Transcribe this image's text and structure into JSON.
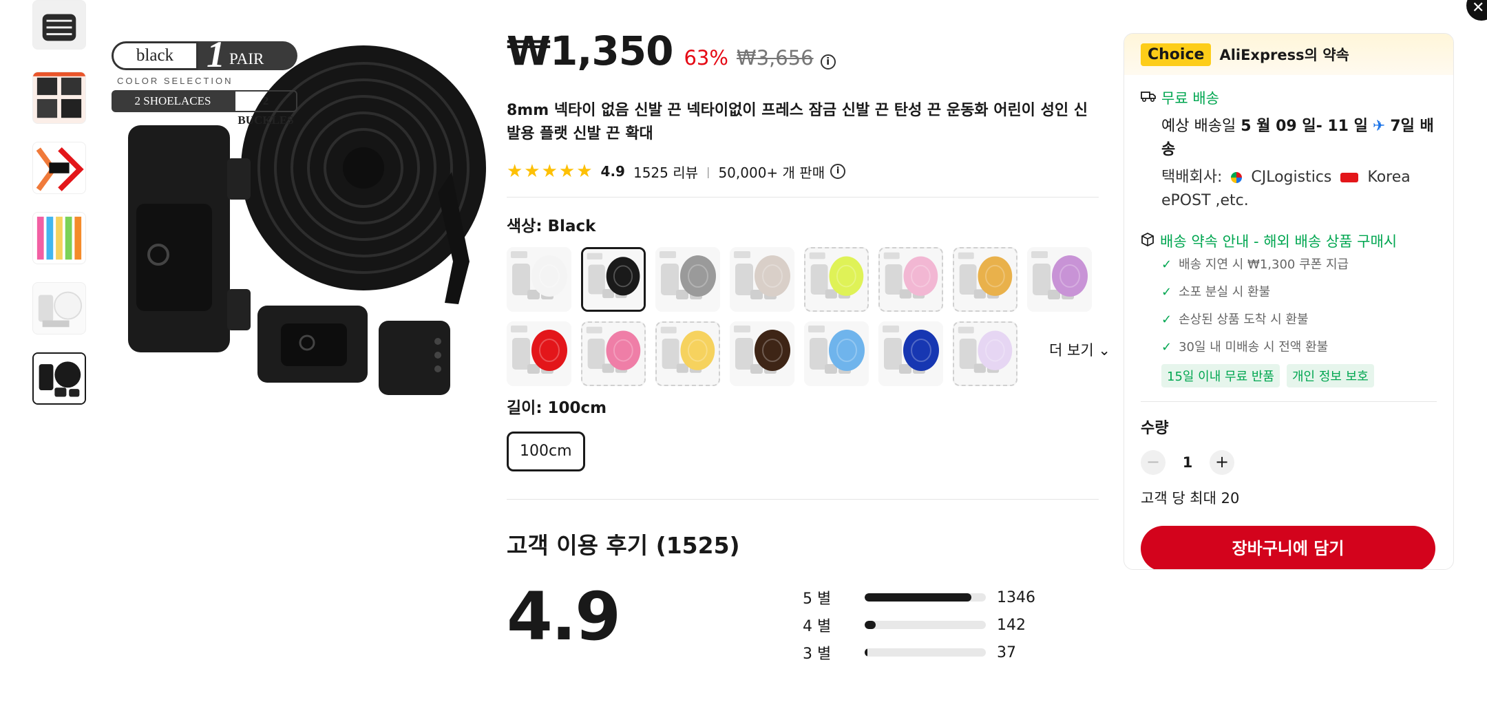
{
  "product": {
    "price": "₩1,350",
    "discount": "63%",
    "original_price": "₩3,656",
    "title": "8mm 넥타이 없음 신발 끈 넥타이없이 프레스 잠금 신발 끈 탄성 끈 운동화 어린이 성인 신발용 플랫 신발 끈 확대",
    "stars": "★★★★★",
    "rating": "4.9",
    "reviews": "1525 리뷰",
    "sold": "50,000+ 개 판매",
    "color_label": "색상: Black",
    "length_label": "길이: 100cm",
    "length_option": "100cm",
    "more_label": "더 보기"
  },
  "image_overlay": {
    "color_word": "black",
    "pair_count": "1",
    "pair_word": "PAIR",
    "color_selection": "COLOR SELECTION",
    "shoelaces": "2 SHOELACES",
    "buckles": "2 BUCKLES"
  },
  "swatches": [
    {
      "color": "#f4f4f4",
      "dashed": false
    },
    {
      "color": "#1a1a1a",
      "dashed": false,
      "selected": true
    },
    {
      "color": "#9a9a9a",
      "dashed": false
    },
    {
      "color": "#d9cfc8",
      "dashed": false
    },
    {
      "color": "#dff257",
      "dashed": true
    },
    {
      "color": "#f2b7d3",
      "dashed": true
    },
    {
      "color": "#e9b14b",
      "dashed": true
    },
    {
      "color": "#c893d6",
      "dashed": false
    },
    {
      "color": "#e3161a",
      "dashed": false
    },
    {
      "color": "#ef7ea7",
      "dashed": true
    },
    {
      "color": "#f6d25e",
      "dashed": true
    },
    {
      "color": "#3e2516",
      "dashed": false
    },
    {
      "color": "#6fb4ec",
      "dashed": false
    },
    {
      "color": "#1737b2",
      "dashed": false
    },
    {
      "color": "#e6d6f3",
      "dashed": true
    }
  ],
  "reviews": {
    "title": "고객 이용 후기 (1525)",
    "average": "4.9",
    "rows": [
      {
        "label": "5 별",
        "count": "1346",
        "fraction": 0.88
      },
      {
        "label": "4 별",
        "count": "142",
        "fraction": 0.09
      },
      {
        "label": "3 별",
        "count": "37",
        "fraction": 0.02
      }
    ]
  },
  "panel": {
    "choice": "Choice",
    "promise": "AliExpress의 약속",
    "free_shipping": "무료 배송",
    "delivery_prefix": "예상 배송일",
    "delivery_dates": "5 월 09 일- 11 일",
    "delivery_days": "7일 배송",
    "carrier_label": "택배회사:",
    "carrier_1": "CJLogistics",
    "carrier_2": "Korea ePOST ,etc.",
    "guarantee_title": "배송 약속 안내 - 해외 배송 상품 구매시",
    "guarantees": [
      "배송 지연 시 ₩1,300 쿠폰 지급",
      "소포 분실 시 환불",
      "손상된 상품 도착 시 환불",
      "30일 내 미배송 시 전액 환불"
    ],
    "tags": [
      "15일 이내 무료 반품",
      "개인 정보 보호"
    ],
    "qty_label": "수량",
    "qty_value": "1",
    "max_note": "고객 당 최대 20",
    "cart_button": "장바구니에 담기"
  },
  "colors": {
    "accent_red": "#d3031c",
    "green": "#00a650",
    "choice_yellow": "#fdcd19",
    "star": "#fdc005"
  }
}
